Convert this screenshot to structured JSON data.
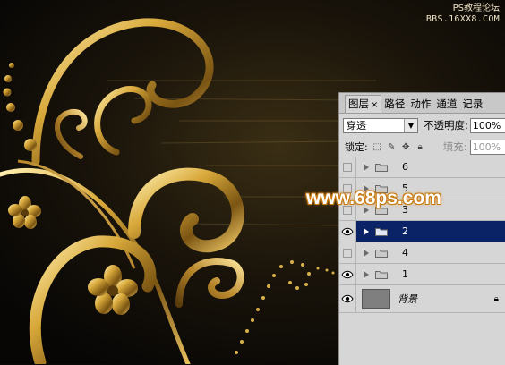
{
  "watermark": {
    "line1": "PS教程论坛",
    "line2": "BBS.16XX8.COM",
    "center": "www.68ps.com"
  },
  "panel": {
    "tabs": [
      {
        "label": "图层",
        "active": true
      },
      {
        "label": "路径"
      },
      {
        "label": "动作"
      },
      {
        "label": "通道"
      },
      {
        "label": "记录"
      }
    ],
    "close_glyph": "×",
    "blend_mode": "穿透",
    "opacity_label": "不透明度:",
    "opacity_value": "100%",
    "lock_label": "锁定:",
    "fill_label": "填充:",
    "fill_value": "100%",
    "layers": [
      {
        "name": "6",
        "visible": false,
        "selected": false
      },
      {
        "name": "5",
        "visible": false,
        "selected": false
      },
      {
        "name": "3",
        "visible": false,
        "selected": false
      },
      {
        "name": "2",
        "visible": true,
        "selected": true
      },
      {
        "name": "4",
        "visible": false,
        "selected": false
      },
      {
        "name": "1",
        "visible": true,
        "selected": false
      }
    ],
    "background_layer": {
      "name": "背景",
      "visible": true,
      "locked": true
    }
  },
  "colors": {
    "selection": "#0a2266",
    "gold": "#d8b04a",
    "watermark_glow": "#c87a10"
  }
}
